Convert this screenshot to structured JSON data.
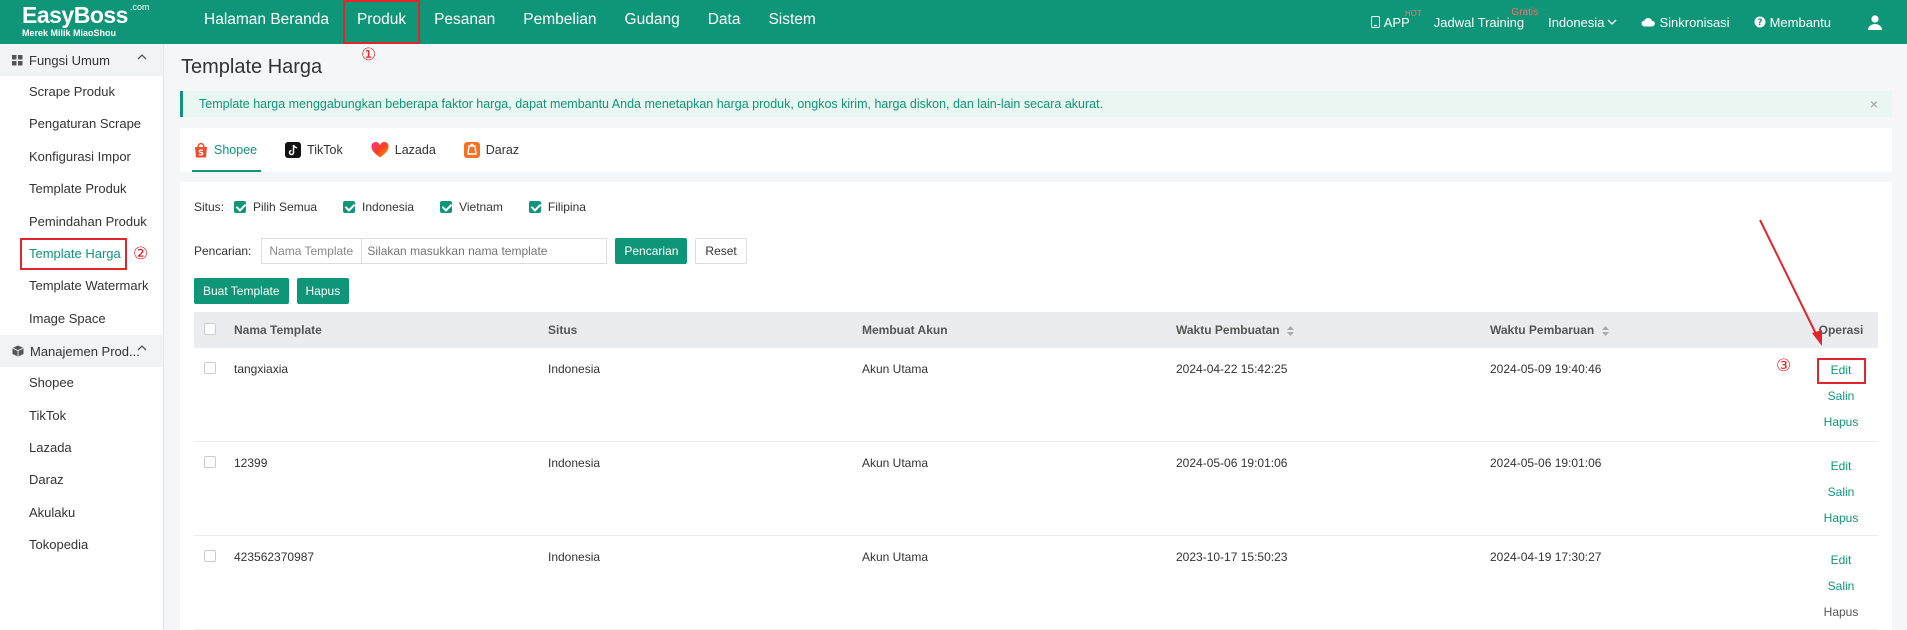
{
  "logo": {
    "brand": "EasyBoss",
    "com": ".com",
    "sub": "Merek Milik MiaoShou"
  },
  "nav": [
    {
      "label": "Halaman Beranda"
    },
    {
      "label": "Produk"
    },
    {
      "label": "Pesanan"
    },
    {
      "label": "Pembelian"
    },
    {
      "label": "Gudang"
    },
    {
      "label": "Data"
    },
    {
      "label": "Sistem"
    }
  ],
  "top_right": {
    "app": "APP",
    "app_badge": "HOT",
    "training": "Jadwal Training",
    "training_badge": "Gratis",
    "country": "Indonesia",
    "sync": "Sinkronisasi",
    "help": "Membantu"
  },
  "sidebar": {
    "group1": "Fungsi Umum",
    "items1": [
      "Scrape Produk",
      "Pengaturan Scrape",
      "Konfigurasi Impor",
      "Template Produk",
      "Pemindahan Produk",
      "Template Harga",
      "Template Watermark",
      "Image Space"
    ],
    "group2": "Manajemen Prod...",
    "items2": [
      "Shopee",
      "TikTok",
      "Lazada",
      "Daraz",
      "Akulaku",
      "Tokopedia"
    ]
  },
  "page": {
    "title": "Template Harga",
    "alert": "Template harga menggabungkan beberapa faktor harga, dapat membantu Anda menetapkan harga produk, ongkos kirim, harga diskon, dan lain-lain secara akurat.",
    "alert_close": "×"
  },
  "tabs": [
    {
      "label": "Shopee"
    },
    {
      "label": "TikTok"
    },
    {
      "label": "Lazada"
    },
    {
      "label": "Daraz"
    }
  ],
  "filters": {
    "site_label": "Situs:",
    "site_options": [
      "Pilih Semua",
      "Indonesia",
      "Vietnam",
      "Filipina"
    ],
    "search_label": "Pencarian:",
    "search_field": "Nama Template",
    "search_placeholder": "Silakan masukkan nama template",
    "search_button": "Pencarian",
    "reset_button": "Reset"
  },
  "actions": {
    "create": "Buat Template",
    "delete": "Hapus"
  },
  "table": {
    "headers": [
      "Nama Template",
      "Situs",
      "Membuat Akun",
      "Waktu Pembuatan",
      "Waktu Pembaruan",
      "Operasi"
    ],
    "rows": [
      {
        "name": "tangxiaxia",
        "site": "Indonesia",
        "account": "Akun Utama",
        "created": "2024-04-22 15:42:25",
        "updated": "2024-05-09 19:40:46"
      },
      {
        "name": "12399",
        "site": "Indonesia",
        "account": "Akun Utama",
        "created": "2024-05-06 19:01:06",
        "updated": "2024-05-06 19:01:06"
      },
      {
        "name": "423562370987",
        "site": "Indonesia",
        "account": "Akun Utama",
        "created": "2023-10-17 15:50:23",
        "updated": "2024-04-19 17:30:27"
      }
    ],
    "ops": {
      "edit": "Edit",
      "copy": "Salin",
      "delete": "Hapus"
    }
  },
  "markers": [
    "①",
    "②",
    "③"
  ],
  "colors": {
    "brand": "#0f9577",
    "highlight": "#e0262a"
  }
}
